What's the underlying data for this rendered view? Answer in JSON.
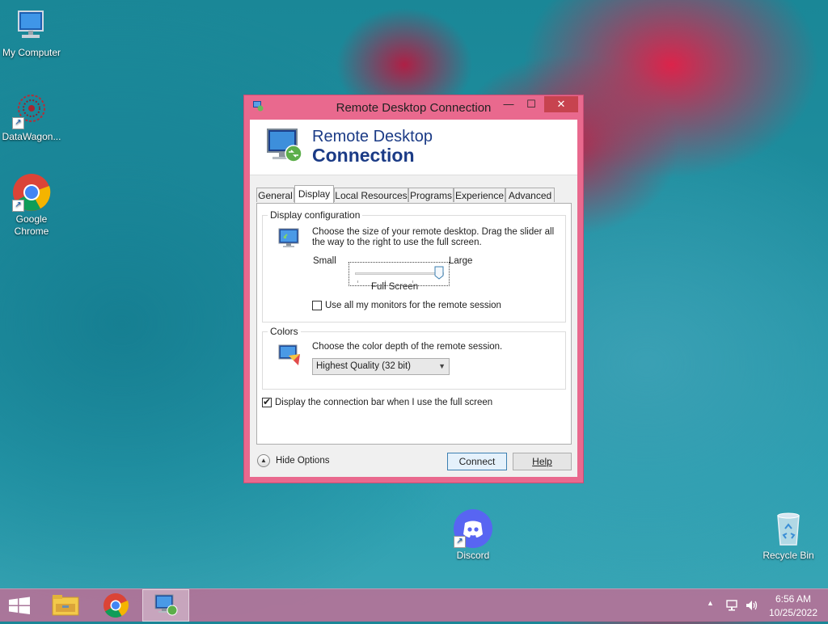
{
  "desktop": {
    "icons": [
      {
        "label": "My Computer",
        "icon": "computer-icon"
      },
      {
        "label": "DataWagon...",
        "icon": "datawagon-icon"
      },
      {
        "label": "Google Chrome",
        "icon": "chrome-icon"
      },
      {
        "label": "Discord",
        "icon": "discord-icon"
      },
      {
        "label": "Recycle Bin",
        "icon": "recycle-bin-icon"
      }
    ]
  },
  "dialog": {
    "title": "Remote Desktop Connection",
    "banner_line1": "Remote Desktop",
    "banner_line2": "Connection",
    "tabs": [
      {
        "label": "General"
      },
      {
        "label": "Display",
        "active": true
      },
      {
        "label": "Local Resources"
      },
      {
        "label": "Programs"
      },
      {
        "label": "Experience"
      },
      {
        "label": "Advanced"
      }
    ],
    "display_config": {
      "group_label": "Display configuration",
      "description": "Choose the size of your remote desktop. Drag the slider all the way to the right to use the full screen.",
      "slider_min_label": "Small",
      "slider_max_label": "Large",
      "slider_value_label": "Full Screen",
      "slider_fraction": 1.0,
      "all_monitors_label": "Use all my monitors for the remote session",
      "all_monitors_checked": false
    },
    "colors": {
      "group_label": "Colors",
      "description": "Choose the color depth of the remote session.",
      "selected": "Highest Quality (32 bit)"
    },
    "connection_bar_label": "Display the connection bar when I use the full screen",
    "connection_bar_checked": true,
    "hide_options_label": "Hide Options",
    "connect_label": "Connect",
    "help_label": "Help"
  },
  "taskbar": {
    "items": [
      "start-icon",
      "file-explorer-icon",
      "chrome-icon",
      "remote-desktop-icon"
    ],
    "time": "6:56 AM",
    "date": "10/25/2022"
  },
  "colors": {
    "title_frame": "#e9698e",
    "close_button": "#c7434f",
    "banner_text": "#1b3b86"
  }
}
